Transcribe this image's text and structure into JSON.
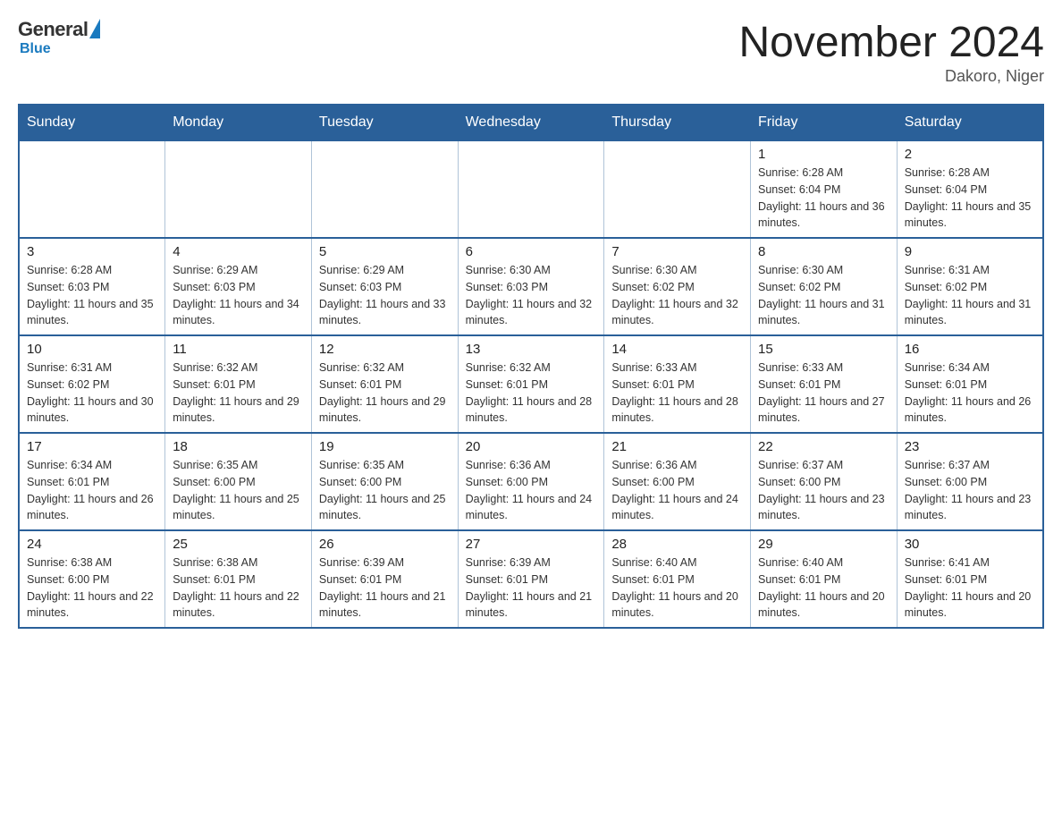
{
  "logo": {
    "general": "General",
    "blue": "Blue"
  },
  "header": {
    "title": "November 2024",
    "location": "Dakoro, Niger"
  },
  "days_of_week": [
    "Sunday",
    "Monday",
    "Tuesday",
    "Wednesday",
    "Thursday",
    "Friday",
    "Saturday"
  ],
  "weeks": [
    {
      "days": [
        {
          "num": "",
          "info": ""
        },
        {
          "num": "",
          "info": ""
        },
        {
          "num": "",
          "info": ""
        },
        {
          "num": "",
          "info": ""
        },
        {
          "num": "",
          "info": ""
        },
        {
          "num": "1",
          "info": "Sunrise: 6:28 AM\nSunset: 6:04 PM\nDaylight: 11 hours and 36 minutes."
        },
        {
          "num": "2",
          "info": "Sunrise: 6:28 AM\nSunset: 6:04 PM\nDaylight: 11 hours and 35 minutes."
        }
      ]
    },
    {
      "days": [
        {
          "num": "3",
          "info": "Sunrise: 6:28 AM\nSunset: 6:03 PM\nDaylight: 11 hours and 35 minutes."
        },
        {
          "num": "4",
          "info": "Sunrise: 6:29 AM\nSunset: 6:03 PM\nDaylight: 11 hours and 34 minutes."
        },
        {
          "num": "5",
          "info": "Sunrise: 6:29 AM\nSunset: 6:03 PM\nDaylight: 11 hours and 33 minutes."
        },
        {
          "num": "6",
          "info": "Sunrise: 6:30 AM\nSunset: 6:03 PM\nDaylight: 11 hours and 32 minutes."
        },
        {
          "num": "7",
          "info": "Sunrise: 6:30 AM\nSunset: 6:02 PM\nDaylight: 11 hours and 32 minutes."
        },
        {
          "num": "8",
          "info": "Sunrise: 6:30 AM\nSunset: 6:02 PM\nDaylight: 11 hours and 31 minutes."
        },
        {
          "num": "9",
          "info": "Sunrise: 6:31 AM\nSunset: 6:02 PM\nDaylight: 11 hours and 31 minutes."
        }
      ]
    },
    {
      "days": [
        {
          "num": "10",
          "info": "Sunrise: 6:31 AM\nSunset: 6:02 PM\nDaylight: 11 hours and 30 minutes."
        },
        {
          "num": "11",
          "info": "Sunrise: 6:32 AM\nSunset: 6:01 PM\nDaylight: 11 hours and 29 minutes."
        },
        {
          "num": "12",
          "info": "Sunrise: 6:32 AM\nSunset: 6:01 PM\nDaylight: 11 hours and 29 minutes."
        },
        {
          "num": "13",
          "info": "Sunrise: 6:32 AM\nSunset: 6:01 PM\nDaylight: 11 hours and 28 minutes."
        },
        {
          "num": "14",
          "info": "Sunrise: 6:33 AM\nSunset: 6:01 PM\nDaylight: 11 hours and 28 minutes."
        },
        {
          "num": "15",
          "info": "Sunrise: 6:33 AM\nSunset: 6:01 PM\nDaylight: 11 hours and 27 minutes."
        },
        {
          "num": "16",
          "info": "Sunrise: 6:34 AM\nSunset: 6:01 PM\nDaylight: 11 hours and 26 minutes."
        }
      ]
    },
    {
      "days": [
        {
          "num": "17",
          "info": "Sunrise: 6:34 AM\nSunset: 6:01 PM\nDaylight: 11 hours and 26 minutes."
        },
        {
          "num": "18",
          "info": "Sunrise: 6:35 AM\nSunset: 6:00 PM\nDaylight: 11 hours and 25 minutes."
        },
        {
          "num": "19",
          "info": "Sunrise: 6:35 AM\nSunset: 6:00 PM\nDaylight: 11 hours and 25 minutes."
        },
        {
          "num": "20",
          "info": "Sunrise: 6:36 AM\nSunset: 6:00 PM\nDaylight: 11 hours and 24 minutes."
        },
        {
          "num": "21",
          "info": "Sunrise: 6:36 AM\nSunset: 6:00 PM\nDaylight: 11 hours and 24 minutes."
        },
        {
          "num": "22",
          "info": "Sunrise: 6:37 AM\nSunset: 6:00 PM\nDaylight: 11 hours and 23 minutes."
        },
        {
          "num": "23",
          "info": "Sunrise: 6:37 AM\nSunset: 6:00 PM\nDaylight: 11 hours and 23 minutes."
        }
      ]
    },
    {
      "days": [
        {
          "num": "24",
          "info": "Sunrise: 6:38 AM\nSunset: 6:00 PM\nDaylight: 11 hours and 22 minutes."
        },
        {
          "num": "25",
          "info": "Sunrise: 6:38 AM\nSunset: 6:01 PM\nDaylight: 11 hours and 22 minutes."
        },
        {
          "num": "26",
          "info": "Sunrise: 6:39 AM\nSunset: 6:01 PM\nDaylight: 11 hours and 21 minutes."
        },
        {
          "num": "27",
          "info": "Sunrise: 6:39 AM\nSunset: 6:01 PM\nDaylight: 11 hours and 21 minutes."
        },
        {
          "num": "28",
          "info": "Sunrise: 6:40 AM\nSunset: 6:01 PM\nDaylight: 11 hours and 20 minutes."
        },
        {
          "num": "29",
          "info": "Sunrise: 6:40 AM\nSunset: 6:01 PM\nDaylight: 11 hours and 20 minutes."
        },
        {
          "num": "30",
          "info": "Sunrise: 6:41 AM\nSunset: 6:01 PM\nDaylight: 11 hours and 20 minutes."
        }
      ]
    }
  ]
}
